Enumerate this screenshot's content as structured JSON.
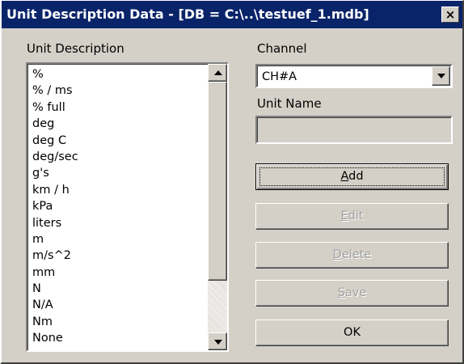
{
  "window": {
    "title": "Unit Description Data - [DB = C:\\..\\testuef_1.mdb]",
    "close_label": "×"
  },
  "unit_description": {
    "label": "Unit Description",
    "items": [
      "%",
      "% / ms",
      "% full",
      "deg",
      "deg C",
      "deg/sec",
      "g's",
      "km / h",
      "kPa",
      "liters",
      "m",
      "m/s^2",
      "mm",
      "N",
      "N/A",
      "Nm",
      "None"
    ]
  },
  "channel": {
    "label": "Channel",
    "selected": "CH#A"
  },
  "unit_name": {
    "label": "Unit Name",
    "value": ""
  },
  "buttons": {
    "add": {
      "accel": "A",
      "rest": "dd",
      "enabled": true
    },
    "edit": {
      "accel": "E",
      "rest": "dit",
      "enabled": false
    },
    "delete": {
      "accel": "D",
      "rest": "elete",
      "enabled": false
    },
    "save": {
      "accel": "S",
      "rest": "ave",
      "enabled": false
    },
    "ok": {
      "label": "OK",
      "enabled": true
    }
  },
  "colors": {
    "titlebar": "#0a246a",
    "face": "#d4d0c8",
    "disabled_text": "#a0a0a0"
  }
}
